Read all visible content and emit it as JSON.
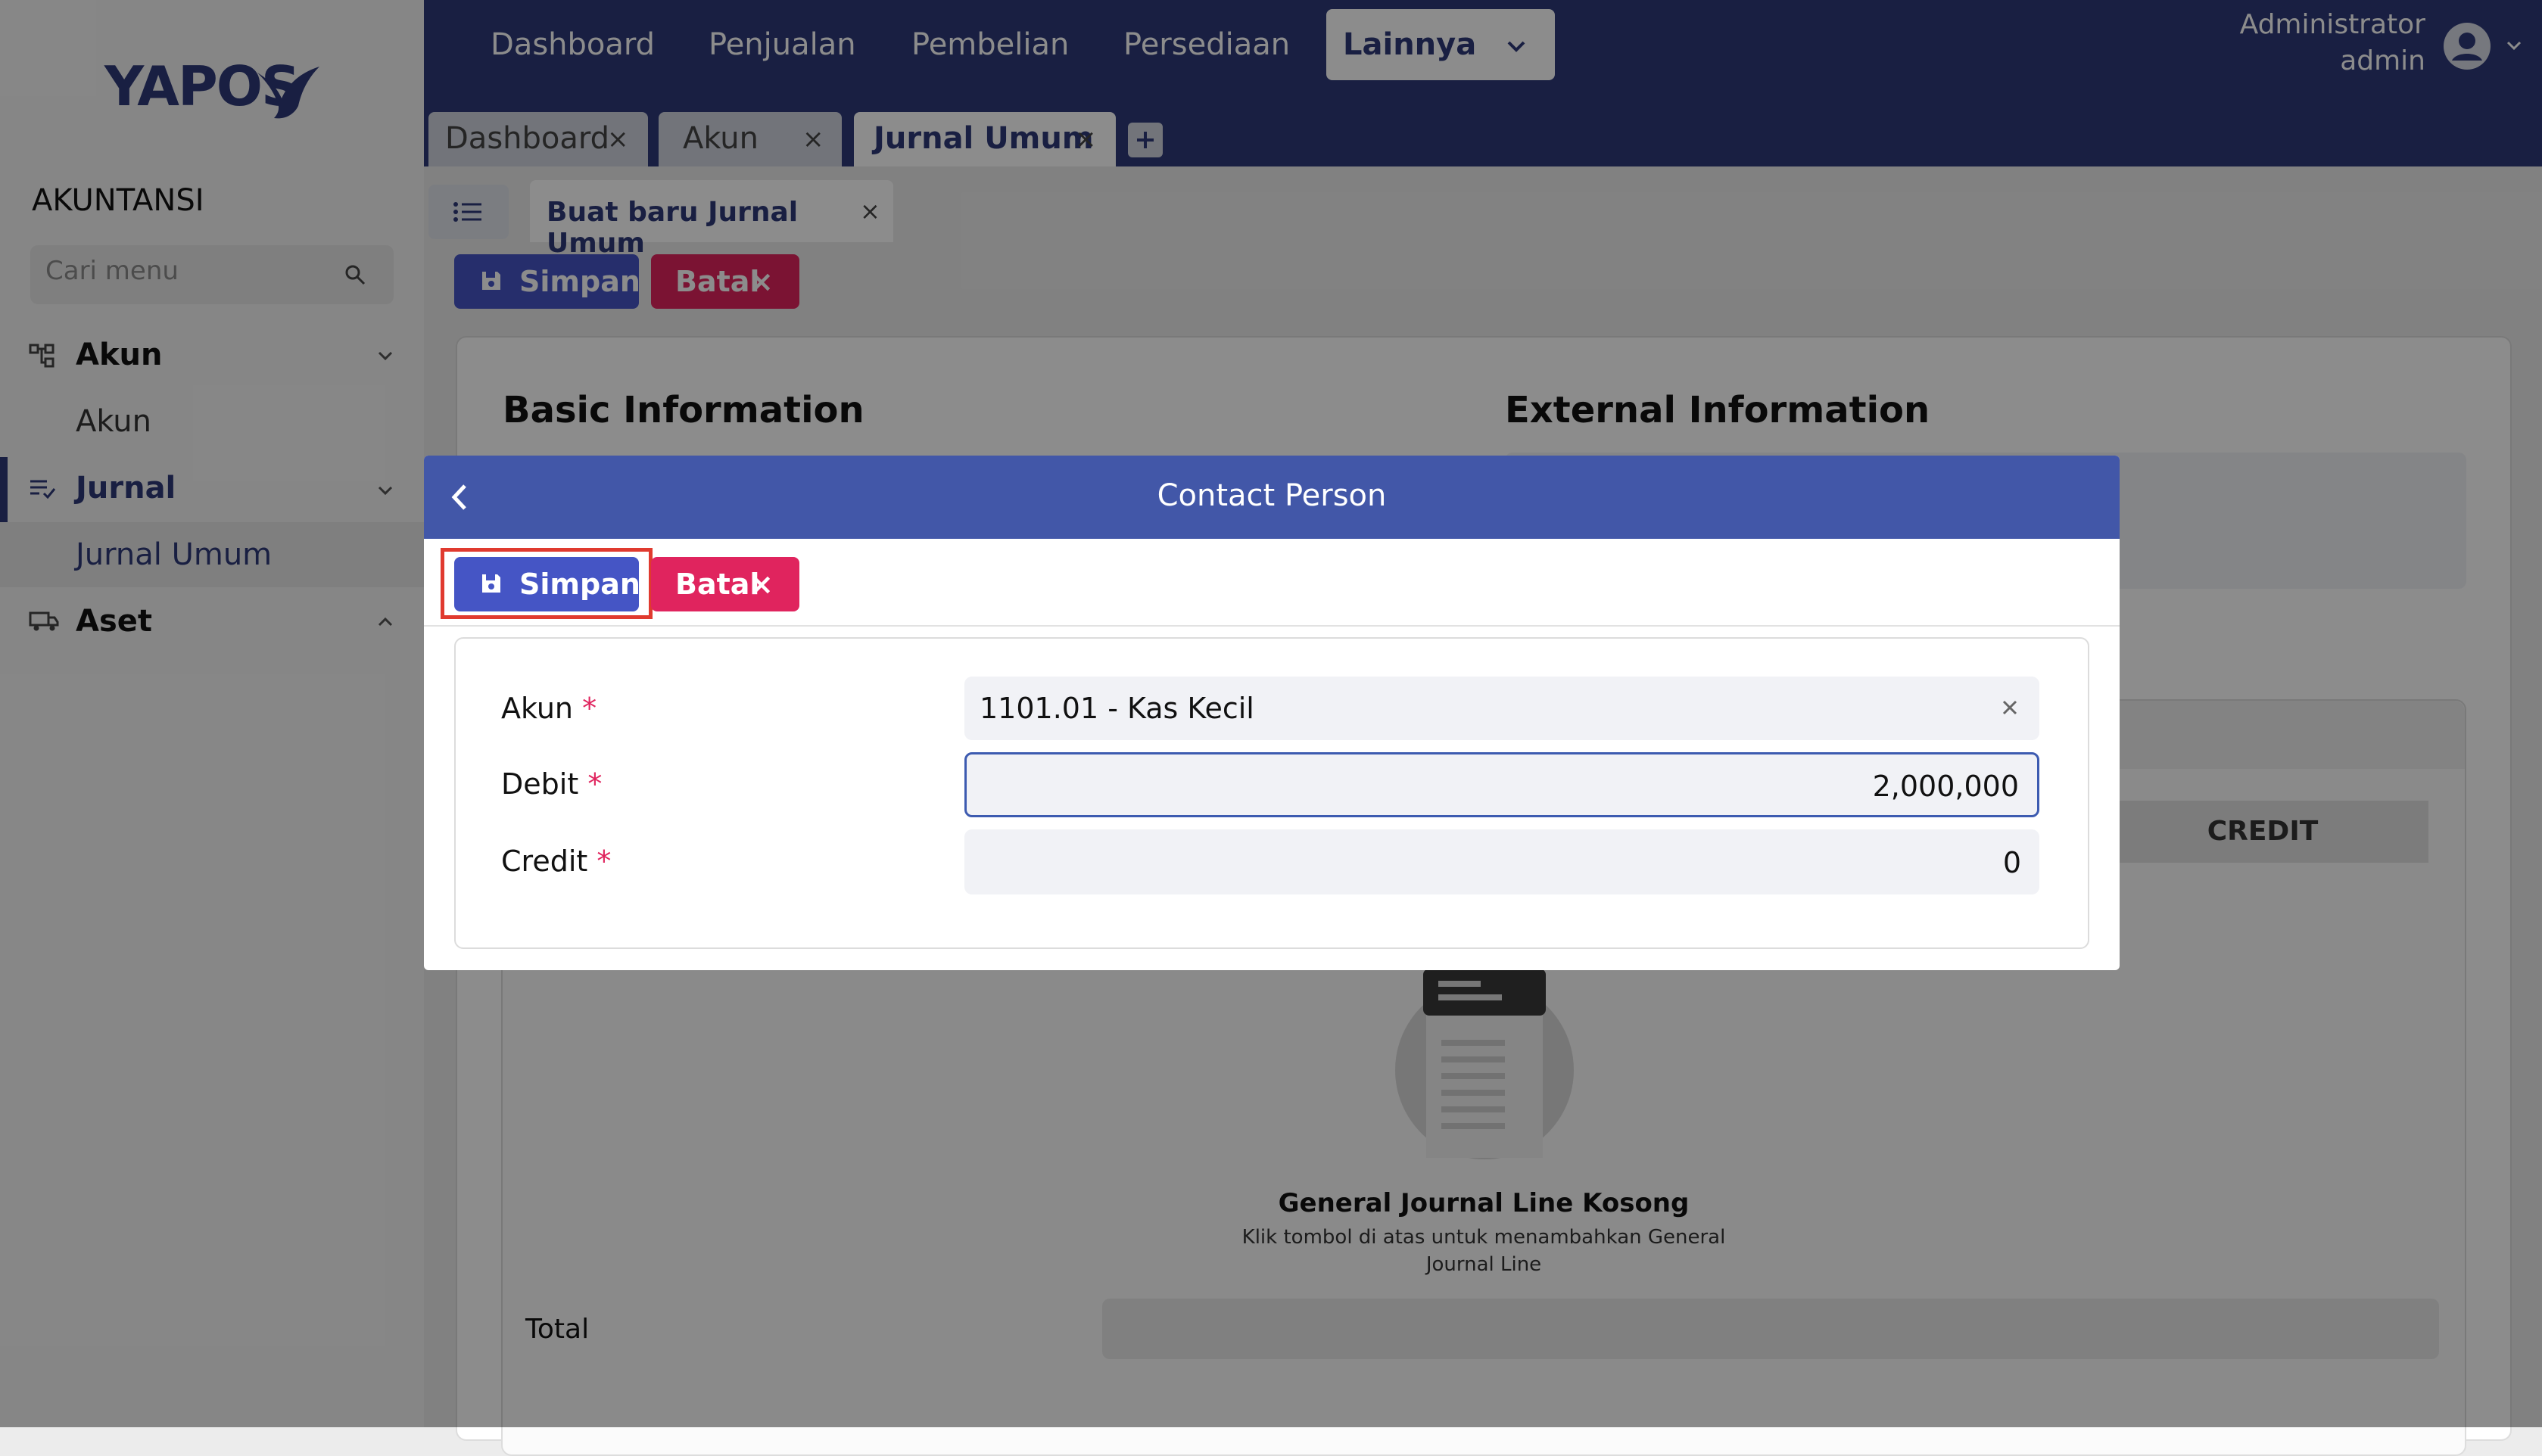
{
  "sidebar": {
    "logo": "YAPOS",
    "section": "AKUNTANSI",
    "search_placeholder": "Cari menu",
    "items": [
      {
        "label": "Akun",
        "sub": "Akun"
      },
      {
        "label": "Jurnal",
        "sub": "Jurnal Umum"
      },
      {
        "label": "Aset"
      }
    ]
  },
  "topnav": {
    "items": [
      "Dashboard",
      "Penjualan",
      "Pembelian",
      "Persediaan"
    ],
    "more": "Lainnya",
    "user_name": "Administrator",
    "user_role": "admin"
  },
  "tabs": [
    {
      "label": "Dashboard"
    },
    {
      "label": "Akun"
    },
    {
      "label": "Jurnal Umum"
    }
  ],
  "page": {
    "subtab": "Buat baru Jurnal Umum",
    "save": "Simpan",
    "cancel": "Batal",
    "basic_info": "Basic Information",
    "external_info": "External Information",
    "credit_header": "CREDIT",
    "empty_title": "General Journal Line Kosong",
    "empty_desc_1": "Klik tombol di atas untuk menambahkan General",
    "empty_desc_2": "Journal Line",
    "total_label": "Total"
  },
  "modal": {
    "title": "Contact Person",
    "save": "Simpan",
    "cancel": "Batal",
    "fields": {
      "akun_label": "Akun",
      "akun_value": "1101.01 - Kas Kecil",
      "debit_label": "Debit",
      "debit_value": "2,000,000",
      "credit_label": "Credit",
      "credit_value": "0"
    }
  },
  "colors": {
    "primary": "#2e3a78",
    "modal_header": "#4257a8",
    "save_button": "#4555c5",
    "cancel_button": "#e0245e",
    "highlight": "#e03a2f"
  }
}
